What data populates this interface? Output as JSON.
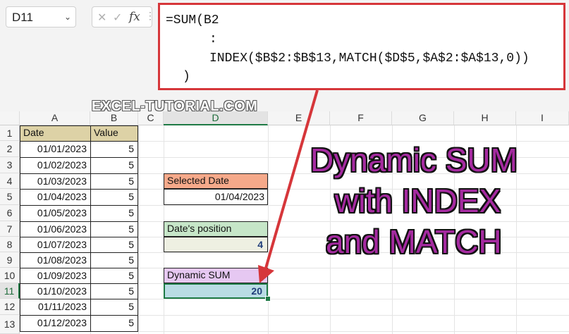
{
  "namebox": {
    "value": "D11",
    "arrow": "⌄"
  },
  "formula_bar": {
    "cancel_icon": "✕",
    "confirm_icon": "✓",
    "fx_label": "fx",
    "separator": "⋮",
    "lines": [
      "=SUM(B2",
      ":",
      "INDEX($B$2:$B$13,MATCH($D$5,$A$2:$A$13,0))",
      ")"
    ]
  },
  "watermark": "EXCEL-TUTORIAL.COM",
  "columns": [
    "A",
    "B",
    "C",
    "D",
    "E",
    "F",
    "G",
    "H",
    "I"
  ],
  "rows": [
    "1",
    "2",
    "3",
    "4",
    "5",
    "6",
    "7",
    "8",
    "9",
    "10",
    "11",
    "12",
    "13"
  ],
  "table": {
    "headers": [
      "Date",
      "Value"
    ],
    "rows": [
      [
        "01/01/2023",
        "5"
      ],
      [
        "01/02/2023",
        "5"
      ],
      [
        "01/03/2023",
        "5"
      ],
      [
        "01/04/2023",
        "5"
      ],
      [
        "01/05/2023",
        "5"
      ],
      [
        "01/06/2023",
        "5"
      ],
      [
        "01/07/2023",
        "5"
      ],
      [
        "01/08/2023",
        "5"
      ],
      [
        "01/09/2023",
        "5"
      ],
      [
        "01/10/2023",
        "5"
      ],
      [
        "01/11/2023",
        "5"
      ],
      [
        "01/12/2023",
        "5"
      ]
    ]
  },
  "side": {
    "selected_date_label": "Selected Date",
    "selected_date_value": "01/04/2023",
    "position_label": "Date's position",
    "position_value": "4",
    "sum_label": "Dynamic SUM",
    "sum_value": "20"
  },
  "overlay_title": [
    "Dynamic SUM",
    "with INDEX",
    "and MATCH"
  ],
  "colors": {
    "header_fill": "#ddd2a6",
    "selected_date_fill": "#f5a98a",
    "position_label_fill": "#c6e6c8",
    "position_value_fill": "#eef0e2",
    "sum_label_fill": "#e6c8f2",
    "sum_value_fill": "#b9dce4",
    "callout_red": "#d6363a",
    "title_purple": "#a52aa0"
  }
}
